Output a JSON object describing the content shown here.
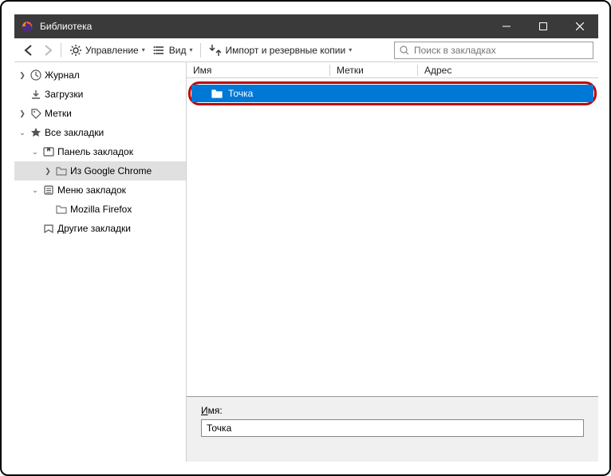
{
  "window": {
    "title": "Библиотека"
  },
  "toolbar": {
    "manage": "Управление",
    "view": "Вид",
    "import": "Импорт и резервные копии"
  },
  "search": {
    "placeholder": "Поиск в закладках"
  },
  "sidebar": {
    "history": "Журнал",
    "downloads": "Загрузки",
    "tags": "Метки",
    "all_bookmarks": "Все закладки",
    "toolbar_folder": "Панель закладок",
    "from_chrome": "Из Google Chrome",
    "menu_folder": "Меню закладок",
    "mozilla": "Mozilla Firefox",
    "other": "Другие закладки"
  },
  "columns": {
    "name": "Имя",
    "tags": "Метки",
    "address": "Адрес"
  },
  "selection": {
    "name": "Точка"
  },
  "details": {
    "name_letter": "И",
    "name_rest": "мя:",
    "value": "Точка"
  }
}
